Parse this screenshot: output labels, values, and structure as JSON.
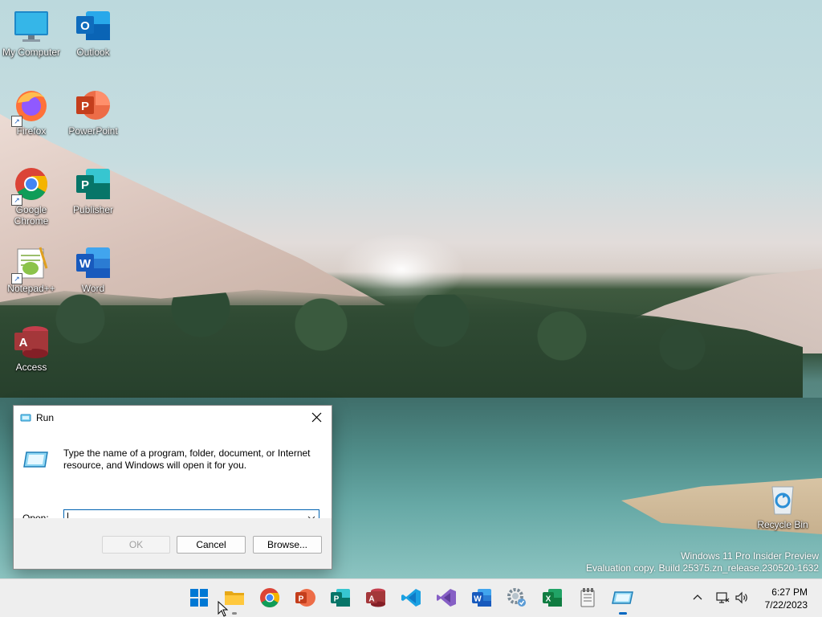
{
  "desktop": {
    "icons": [
      {
        "label": "My Computer",
        "icon": "monitor-icon"
      },
      {
        "label": "Outlook",
        "icon": "outlook-icon"
      },
      {
        "label": "Firefox",
        "icon": "firefox-icon"
      },
      {
        "label": "PowerPoint",
        "icon": "powerpoint-icon"
      },
      {
        "label": "Google Chrome",
        "icon": "chrome-icon"
      },
      {
        "label": "Publisher",
        "icon": "publisher-icon"
      },
      {
        "label": "Notepad++",
        "icon": "notepadpp-icon"
      },
      {
        "label": "Word",
        "icon": "word-icon"
      },
      {
        "label": "Access",
        "icon": "access-icon"
      },
      {
        "label": "Recycle Bin",
        "icon": "recycle-bin-icon"
      }
    ],
    "watermark": {
      "line1": "Windows 11 Pro Insider Preview",
      "line2": "Evaluation copy. Build 25375.zn_release.230520-1632"
    }
  },
  "run_dialog": {
    "title": "Run",
    "description": "Type the name of a program, folder, document, or Internet resource, and Windows will open it for you.",
    "open_label": "Open:",
    "open_value": "",
    "ok_label": "OK",
    "cancel_label": "Cancel",
    "browse_label": "Browse..."
  },
  "taskbar": {
    "apps": [
      {
        "name": "Start",
        "icon": "windows-start-icon"
      },
      {
        "name": "File Explorer",
        "icon": "folder-icon"
      },
      {
        "name": "Google Chrome",
        "icon": "chrome-icon"
      },
      {
        "name": "PowerPoint",
        "icon": "powerpoint-icon"
      },
      {
        "name": "Publisher",
        "icon": "publisher-icon"
      },
      {
        "name": "Access",
        "icon": "access-icon"
      },
      {
        "name": "Visual Studio Code",
        "icon": "vscode-icon"
      },
      {
        "name": "Visual Studio",
        "icon": "visual-studio-icon"
      },
      {
        "name": "Word",
        "icon": "word-icon"
      },
      {
        "name": "Control Panel",
        "icon": "settings-gear-icon"
      },
      {
        "name": "Excel",
        "icon": "excel-icon"
      },
      {
        "name": "Notepad",
        "icon": "notepad-icon"
      },
      {
        "name": "Run",
        "icon": "run-icon"
      }
    ],
    "clock_time": "6:27 PM",
    "clock_date": "7/22/2023"
  },
  "colors": {
    "accent": "#0067c0",
    "taskbar_bg": "#eeeeee",
    "dialog_bg": "#f0f0f0"
  }
}
